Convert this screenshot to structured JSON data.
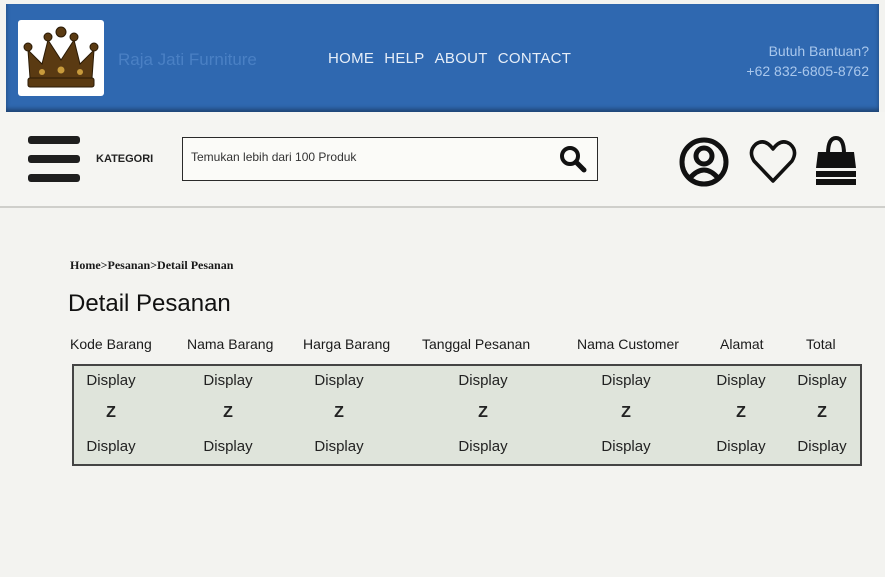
{
  "header": {
    "brand": "Raja Jati Furniture",
    "nav": [
      "HOME",
      "HELP",
      "ABOUT",
      "CONTACT"
    ],
    "help_title": "Butuh Bantuan?",
    "help_phone": "+62 832-6805-8762"
  },
  "toolbar": {
    "kategori_label": "KATEGORI",
    "search_placeholder": "Temukan lebih dari 100 Produk"
  },
  "breadcrumb": [
    "Home",
    "Pesanan",
    "Detail Pesanan"
  ],
  "breadcrumb_sep": ">",
  "page_title": "Detail Pesanan",
  "table": {
    "columns": [
      "Kode Barang",
      "Nama Barang",
      "Harga Barang",
      "Tanggal Pesanan",
      "Nama Customer",
      "Alamat",
      "Total"
    ],
    "rows": [
      [
        "Display",
        "Display",
        "Display",
        "Display",
        "Display",
        "Display",
        "Display"
      ],
      [
        "Z",
        "Z",
        "Z",
        "Z",
        "Z",
        "Z",
        "Z"
      ],
      [
        "Display",
        "Display",
        "Display",
        "Display",
        "Display",
        "Display",
        "Display"
      ]
    ]
  },
  "icons": {
    "logo": "crown-logo-icon",
    "menu": "hamburger-menu-icon",
    "search": "search-icon",
    "user": "user-account-icon",
    "wishlist": "heart-icon",
    "cart": "shopping-bag-icon"
  },
  "colors": {
    "header_bg": "#2f68b0",
    "table_bg": "#dfe4db"
  }
}
